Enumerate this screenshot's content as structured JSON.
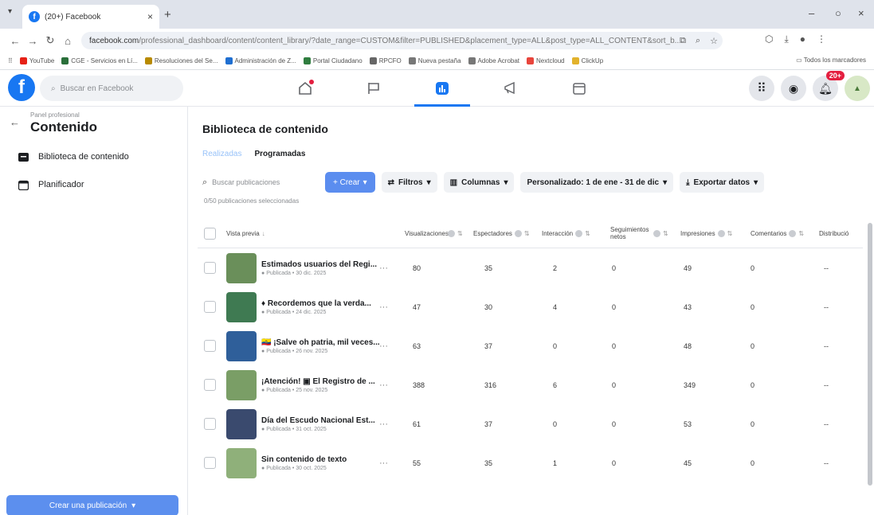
{
  "browser": {
    "tab_title": "(20+) Facebook",
    "url_host": "facebook.com",
    "url_path": "/professional_dashboard/content/content_library/?date_range=CUSTOM&filter=PUBLISHED&placement_type=ALL&post_type=ALL_CONTENT&sort_b...",
    "bookmarks": [
      {
        "label": "YouTube",
        "color": "#e62117"
      },
      {
        "label": "CGE - Servicios en Lí...",
        "color": "#2a6f3a"
      },
      {
        "label": "Resoluciones del Se...",
        "color": "#b88a00"
      },
      {
        "label": "Administración de Z...",
        "color": "#1f6fd1"
      },
      {
        "label": "Portal Ciudadano",
        "color": "#2f7d3f"
      },
      {
        "label": "RPCFO",
        "color": "#666666"
      },
      {
        "label": "Nueva pestaña",
        "color": "#777777"
      },
      {
        "label": "Adobe Acrobat",
        "color": "#777777"
      },
      {
        "label": "Nextcloud",
        "color": "#e8453c"
      },
      {
        "label": "ClickUp",
        "color": "#e2b22c"
      }
    ],
    "all_bookmarks": "Todos los marcadores"
  },
  "fb": {
    "logo": "f",
    "search_placeholder": "Buscar en Facebook",
    "notif_badge": "20+"
  },
  "sidebar": {
    "eyebrow": "Panel profesional",
    "title": "Contenido",
    "items": [
      {
        "label": "Biblioteca de contenido",
        "icon": "content-library-icon"
      },
      {
        "label": "Planificador",
        "icon": "calendar-icon"
      }
    ],
    "create_post": "Crear una publicación"
  },
  "main": {
    "title": "Biblioteca de contenido",
    "tabs": [
      {
        "label": "Realizadas",
        "active": true
      },
      {
        "label": "Programadas",
        "active": false
      }
    ],
    "search_placeholder": "Buscar publicaciones",
    "create_label": "+ Crear",
    "filters_label": "Filtros",
    "columns_label": "Columnas",
    "date_range_label": "Personalizado: 1 de ene - 31 de dic",
    "export_label": "Exportar datos",
    "selected_count": "0/50 publicaciones seleccionadas",
    "columns": {
      "preview": "Vista previa",
      "views": "Visualizaciones",
      "viewers": "Espectadores",
      "interaction": "Interacción",
      "net_follows": "Seguimientos netos",
      "impressions": "Impresiones",
      "comments": "Comentarios",
      "distribution": "Distribució"
    },
    "rows": [
      {
        "title": "Estimados usuarios del Regi...",
        "meta": "Publicada • 30 dic. 2025",
        "views": "80",
        "viewers": "35",
        "interaction": "2",
        "net": "0",
        "impressions": "49",
        "comments": "0",
        "dist": "--",
        "thumb": "#6a8f5a"
      },
      {
        "title": "♦ Recordemos que la verda...",
        "meta": "Publicada • 24 dic. 2025",
        "views": "47",
        "viewers": "30",
        "interaction": "4",
        "net": "0",
        "impressions": "43",
        "comments": "0",
        "dist": "--",
        "thumb": "#3f7a52"
      },
      {
        "title": "🇪🇨 ¡Salve oh patria, mil veces...",
        "meta": "Publicada • 26 nov. 2025",
        "views": "63",
        "viewers": "37",
        "interaction": "0",
        "net": "0",
        "impressions": "48",
        "comments": "0",
        "dist": "--",
        "thumb": "#2f5f9a"
      },
      {
        "title": "¡Atención! ▣ El Registro de ...",
        "meta": "Publicada • 25 nov. 2025",
        "views": "388",
        "viewers": "316",
        "interaction": "6",
        "net": "0",
        "impressions": "349",
        "comments": "0",
        "dist": "--",
        "thumb": "#7a9e66"
      },
      {
        "title": "Día del Escudo Nacional Est...",
        "meta": "Publicada • 31 oct. 2025",
        "views": "61",
        "viewers": "37",
        "interaction": "0",
        "net": "0",
        "impressions": "53",
        "comments": "0",
        "dist": "--",
        "thumb": "#3a4a6e"
      },
      {
        "title": "Sin contenido de texto",
        "meta": "Publicada • 30 oct. 2025",
        "views": "55",
        "viewers": "35",
        "interaction": "1",
        "net": "0",
        "impressions": "45",
        "comments": "0",
        "dist": "--",
        "thumb": "#8fb07a"
      }
    ]
  },
  "colors": {
    "accent": "#1877f2",
    "primary_button": "#5b8def",
    "notification": "#e41e3f"
  }
}
